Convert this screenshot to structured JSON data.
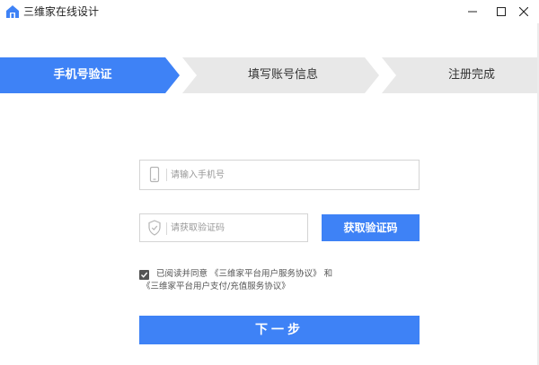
{
  "window": {
    "title": "三维家在线设计",
    "controls": {
      "minimize_icon": "minimize-icon",
      "maximize_icon": "maximize-icon",
      "close_icon": "close-icon"
    }
  },
  "steps": [
    {
      "label": "手机号验证",
      "active": true
    },
    {
      "label": "填写账号信息",
      "active": false
    },
    {
      "label": "注册完成",
      "active": false
    }
  ],
  "form": {
    "phone": {
      "placeholder": "请输入手机号",
      "value": "",
      "icon": "phone-icon"
    },
    "code": {
      "placeholder": "请获取验证码",
      "value": "",
      "icon": "shield-icon"
    },
    "get_code_label": "获取验证码",
    "agreement": {
      "checked": true,
      "prefix": "已阅读并同意",
      "link1": "《三维家平台用户服务协议》",
      "and": "和",
      "link2": "《三维家平台用户支付/充值服务协议》"
    },
    "next_label": "下一步"
  },
  "colors": {
    "accent": "#3e82f6",
    "step_inactive": "#e8e8e8",
    "border": "#d4d4d4"
  }
}
